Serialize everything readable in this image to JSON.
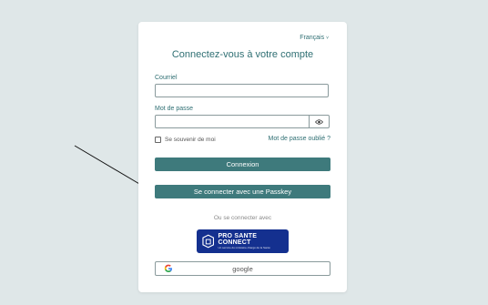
{
  "language": {
    "label": "Français",
    "caret": "˅"
  },
  "title": "Connectez-vous à votre compte",
  "email": {
    "label": "Courriel",
    "value": ""
  },
  "password": {
    "label": "Mot de passe",
    "value": ""
  },
  "remember_label": "Se souvenir de moi",
  "forgot_label": "Mot de passe oublié ?",
  "login_button": "Connexion",
  "passkey_button": "Se connecter avec une Passkey",
  "or_text": "Ou se connecter avec",
  "prosante": {
    "title": "PRO SANTE CONNECT",
    "subtitle": "Un service du ministère chargé de la Santé"
  },
  "google_button": "google",
  "colors": {
    "accent": "#3e7a7c",
    "background": "#dfe7e8",
    "prosante": "#14308f"
  }
}
